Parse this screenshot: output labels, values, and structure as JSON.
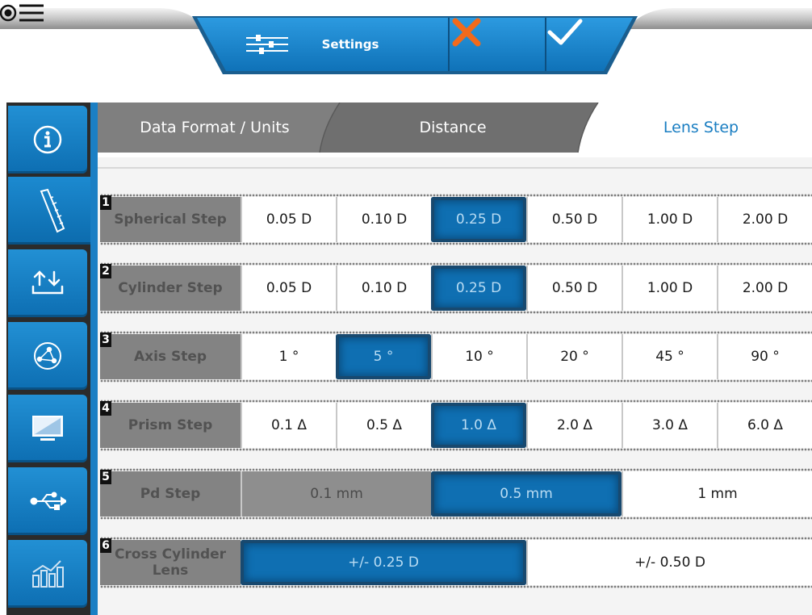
{
  "toolbar": {
    "settings_label": "Settings",
    "colors": {
      "accent": "#1a7fc6",
      "cancel": "#f26a1b"
    }
  },
  "sidebar": {
    "items": [
      {
        "icon": "info-icon",
        "active": false
      },
      {
        "icon": "ruler-icon",
        "active": true
      },
      {
        "icon": "import-export-icon",
        "active": false
      },
      {
        "icon": "globe-network-icon",
        "active": false
      },
      {
        "icon": "monitor-icon",
        "active": false
      },
      {
        "icon": "usb-icon",
        "active": false
      },
      {
        "icon": "statistics-icon",
        "active": false
      }
    ]
  },
  "tabs": [
    {
      "label": "Data Format / Units",
      "active": false
    },
    {
      "label": "Distance",
      "active": false
    },
    {
      "label": "Lens Step",
      "active": true
    }
  ],
  "rows": [
    {
      "num": "1",
      "label": "Spherical Step",
      "options": [
        "0.05 D",
        "0.10 D",
        "0.25 D",
        "0.50 D",
        "1.00 D",
        "2.00 D"
      ],
      "selected": 2
    },
    {
      "num": "2",
      "label": "Cylinder Step",
      "options": [
        "0.05 D",
        "0.10 D",
        "0.25 D",
        "0.50 D",
        "1.00 D",
        "2.00 D"
      ],
      "selected": 2
    },
    {
      "num": "3",
      "label": "Axis Step",
      "options": [
        "1 °",
        "5 °",
        "10 °",
        "20 °",
        "45 °",
        "90 °"
      ],
      "selected": 1
    },
    {
      "num": "4",
      "label": "Prism Step",
      "options": [
        "0.1 Δ",
        "0.5 Δ",
        "1.0 Δ",
        "2.0 Δ",
        "3.0 Δ",
        "6.0 Δ"
      ],
      "selected": 2
    },
    {
      "num": "5",
      "label": "Pd Step",
      "options": [
        "0.1 mm",
        "0.5 mm",
        "1 mm"
      ],
      "selected": 1
    },
    {
      "num": "6",
      "label": "Cross Cylinder Lens",
      "options": [
        "+/- 0.25 D",
        "+/- 0.50 D"
      ],
      "selected": 0
    }
  ]
}
